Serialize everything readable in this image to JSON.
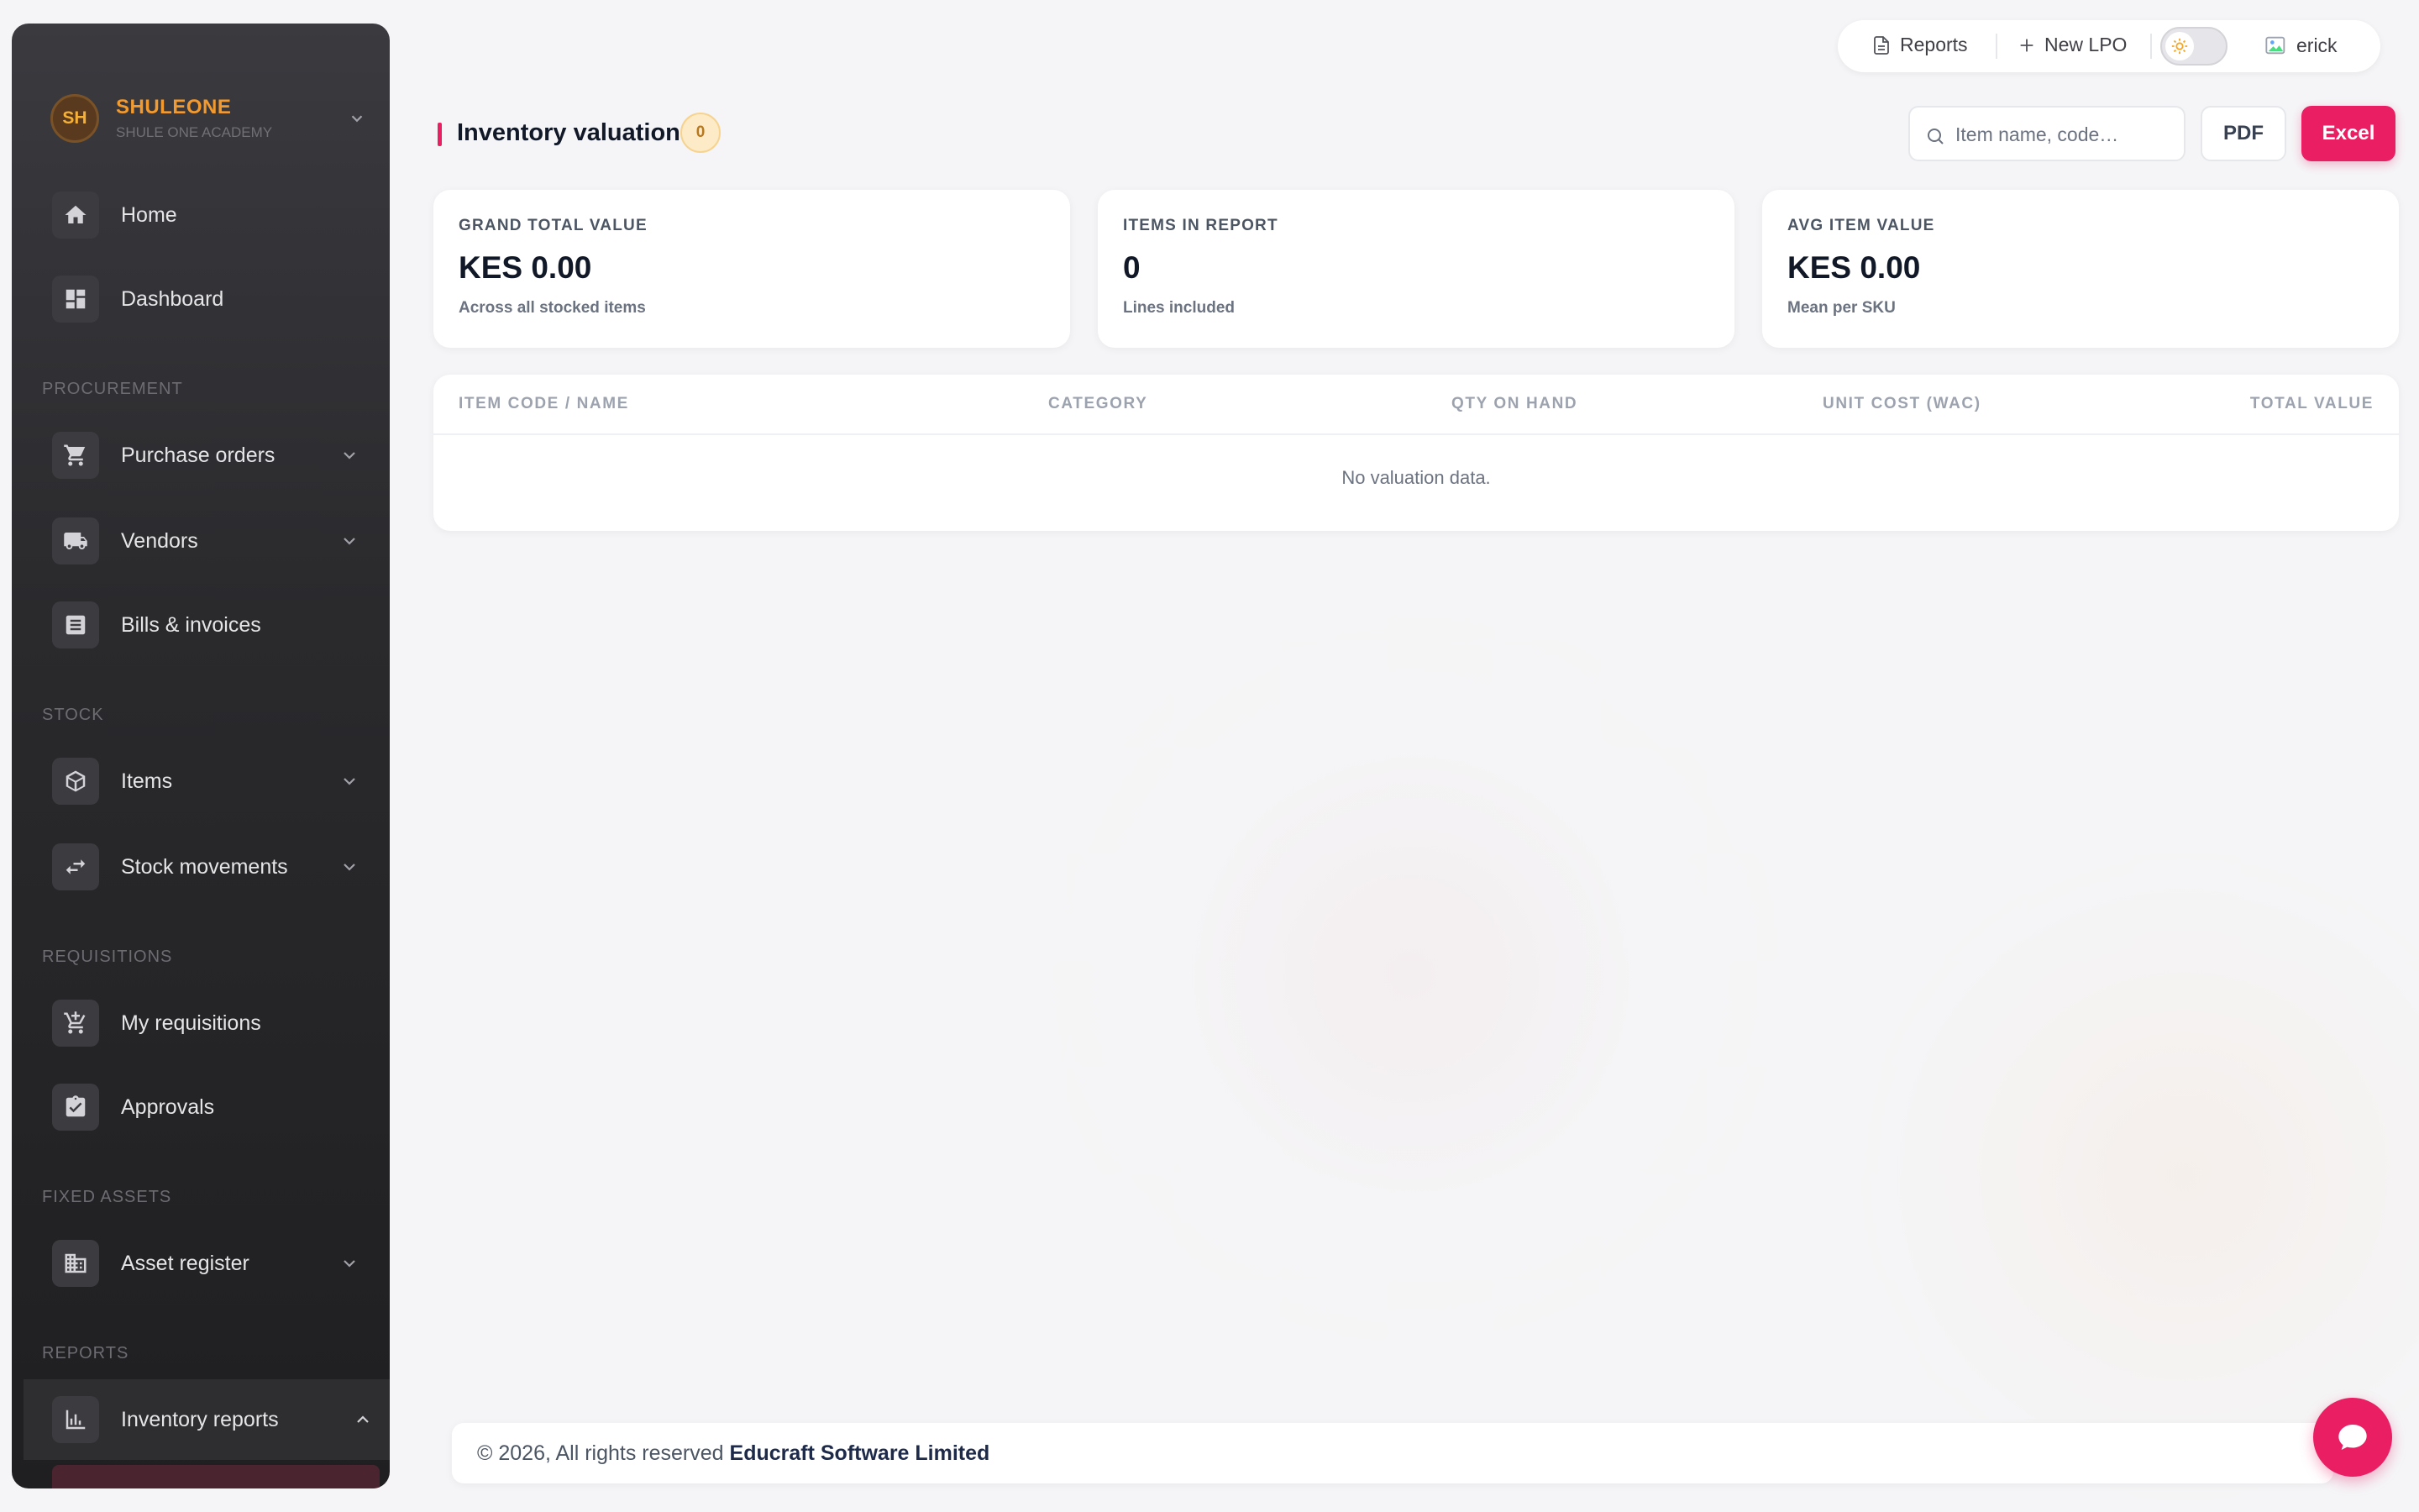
{
  "brand": {
    "initials": "SH",
    "name": "SHULEONE",
    "subtitle": "SHULE ONE ACADEMY"
  },
  "sidebar": {
    "items": [
      {
        "label": "Home",
        "icon": "home-icon"
      },
      {
        "label": "Dashboard",
        "icon": "dashboard-icon"
      },
      {
        "label": "Purchase orders",
        "icon": "cart-icon",
        "expandable": true
      },
      {
        "label": "Vendors",
        "icon": "truck-icon",
        "expandable": true
      },
      {
        "label": "Bills & invoices",
        "icon": "receipt-icon"
      },
      {
        "label": "Items",
        "icon": "box-icon",
        "expandable": true
      },
      {
        "label": "Stock movements",
        "icon": "swap-icon",
        "expandable": true
      },
      {
        "label": "My requisitions",
        "icon": "cart-add-icon"
      },
      {
        "label": "Approvals",
        "icon": "clipboard-check-icon"
      },
      {
        "label": "Asset register",
        "icon": "building-icon",
        "expandable": true
      },
      {
        "label": "Inventory reports",
        "icon": "bar-chart-icon",
        "expandable": true,
        "active": true
      }
    ],
    "sections": [
      "PROCUREMENT",
      "STOCK",
      "REQUISITIONS",
      "FIXED ASSETS",
      "REPORTS"
    ]
  },
  "topbar": {
    "reports_label": "Reports",
    "new_lpo_label": "New LPO",
    "user_name": "erick"
  },
  "page": {
    "title": "Inventory valuation",
    "count": "0"
  },
  "search": {
    "placeholder": "Item name, code…"
  },
  "actions": {
    "pdf_label": "PDF",
    "excel_label": "Excel"
  },
  "stats": [
    {
      "label": "GRAND TOTAL VALUE",
      "value": "KES 0.00",
      "desc": "Across all stocked items"
    },
    {
      "label": "ITEMS IN REPORT",
      "value": "0",
      "desc": "Lines included"
    },
    {
      "label": "AVG ITEM VALUE",
      "value": "KES 0.00",
      "desc": "Mean per SKU"
    }
  ],
  "table": {
    "columns": [
      "ITEM CODE / NAME",
      "CATEGORY",
      "QTY ON HAND",
      "UNIT COST (WAC)",
      "TOTAL VALUE"
    ],
    "empty_text": "No valuation data."
  },
  "footer": {
    "text": "© 2026, All rights reserved",
    "company": "Educraft Software Limited"
  },
  "colors": {
    "accent": "#e91e63",
    "brand": "#f29a2e",
    "sidebar_bg": "#2a2a2d"
  }
}
